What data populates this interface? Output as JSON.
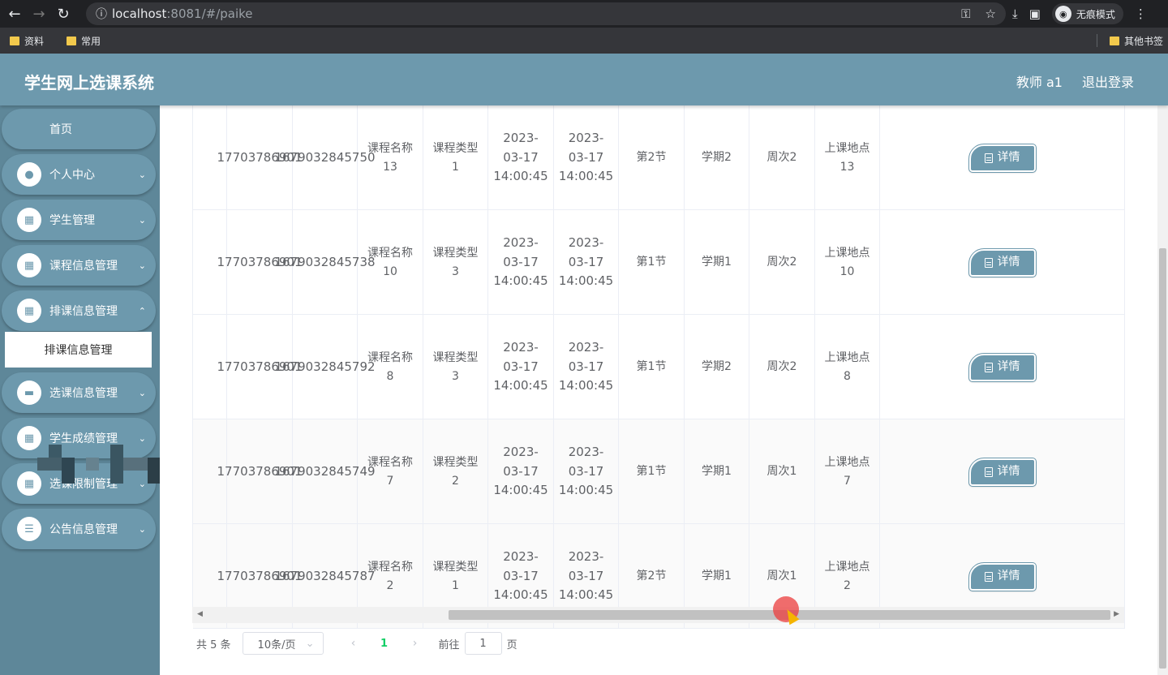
{
  "browser": {
    "url_host": "localhost",
    "url_rest": ":8081/#/paike",
    "incognito_label": "无痕模式",
    "bookmarks": [
      "资料",
      "常用"
    ],
    "other_bookmarks": "其他书签"
  },
  "header": {
    "title": "学生网上选课系统",
    "user": "教师 a1",
    "logout": "退出登录"
  },
  "sidebar": {
    "home": "首页",
    "items": [
      {
        "label": "个人中心",
        "icon": "user-icon"
      },
      {
        "label": "学生管理",
        "icon": "grid-icon"
      },
      {
        "label": "课程信息管理",
        "icon": "grid-icon"
      },
      {
        "label": "排课信息管理",
        "icon": "grid-icon"
      },
      {
        "label": "选课信息管理",
        "icon": "briefcase-icon"
      },
      {
        "label": "学生成绩管理",
        "icon": "grid-icon"
      },
      {
        "label": "选课限制管理",
        "icon": "grid-icon"
      },
      {
        "label": "公告信息管理",
        "icon": "list-icon"
      }
    ],
    "active_sub": "排课信息管理"
  },
  "table": {
    "detail_label": "详情",
    "rows": [
      {
        "c1": "17703786901",
        "c2": "1679032845750",
        "course": "课程名称13",
        "type": "课程类型1",
        "start": "2023-03-17 14:00:45",
        "end": "2023-03-17 14:00:45",
        "section": "第2节",
        "term": "学期2",
        "week": "周次2",
        "place": "上课地点13"
      },
      {
        "c1": "17703786901",
        "c2": "1679032845738",
        "course": "课程名称10",
        "type": "课程类型3",
        "start": "2023-03-17 14:00:45",
        "end": "2023-03-17 14:00:45",
        "section": "第1节",
        "term": "学期1",
        "week": "周次2",
        "place": "上课地点10"
      },
      {
        "c1": "17703786901",
        "c2": "1679032845792",
        "course": "课程名称8",
        "type": "课程类型3",
        "start": "2023-03-17 14:00:45",
        "end": "2023-03-17 14:00:45",
        "section": "第1节",
        "term": "学期2",
        "week": "周次2",
        "place": "上课地点8"
      },
      {
        "c1": "17703786901",
        "c2": "1679032845749",
        "course": "课程名称7",
        "type": "课程类型2",
        "start": "2023-03-17 14:00:45",
        "end": "2023-03-17 14:00:45",
        "section": "第1节",
        "term": "学期1",
        "week": "周次1",
        "place": "上课地点7"
      },
      {
        "c1": "17703786901",
        "c2": "1679032845787",
        "course": "课程名称2",
        "type": "课程类型1",
        "start": "2023-03-17 14:00:45",
        "end": "2023-03-17 14:00:45",
        "section": "第2节",
        "term": "学期1",
        "week": "周次1",
        "place": "上课地点2"
      }
    ]
  },
  "pagination": {
    "total": "共 5 条",
    "page_size": "10条/页",
    "current_page": "1",
    "goto_prefix": "前往",
    "goto_value": "1",
    "goto_suffix": "页"
  },
  "colors": {
    "header": "#6d99ad",
    "sidebar": "#5e8799",
    "page_active": "#13ce66"
  }
}
